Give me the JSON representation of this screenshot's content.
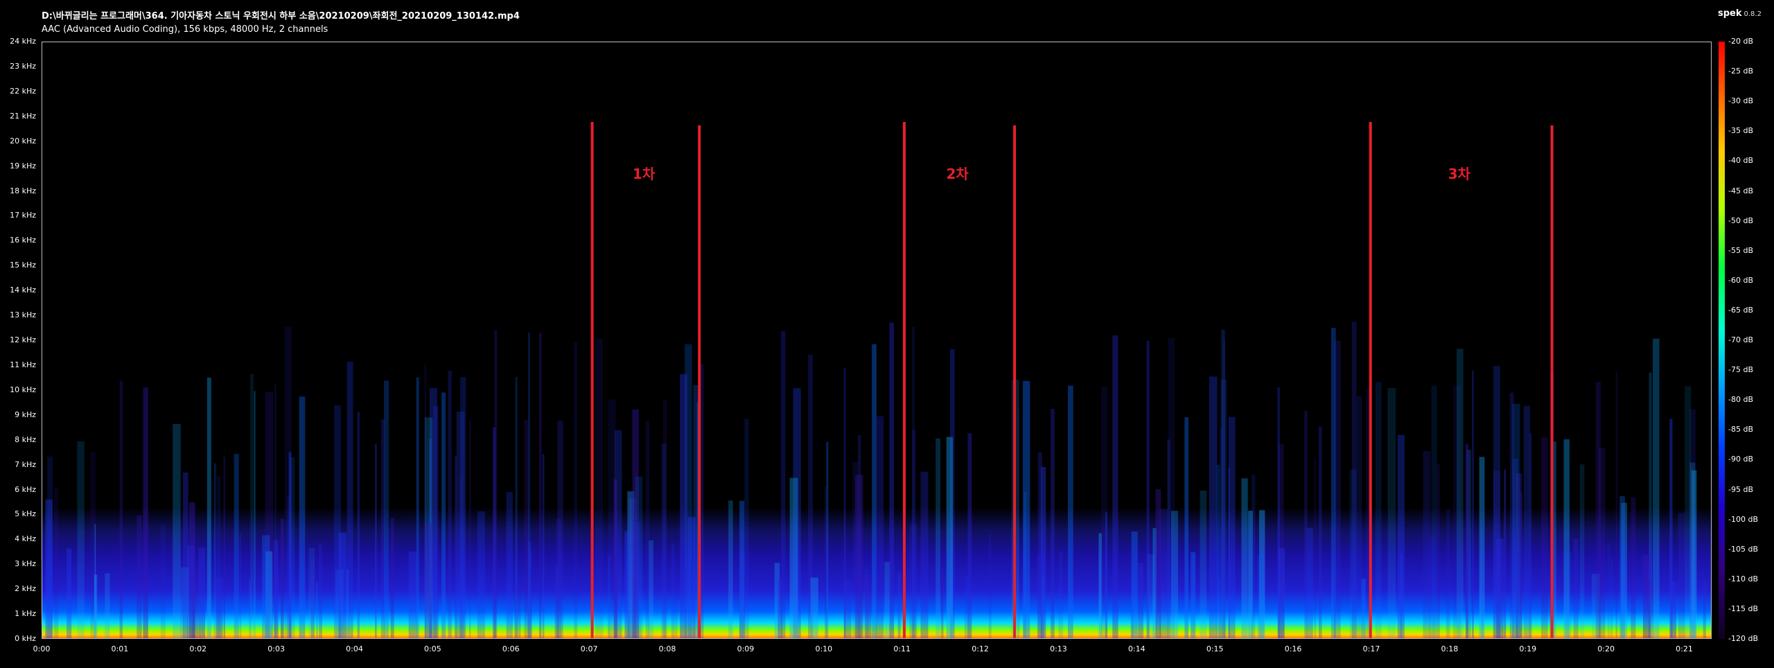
{
  "window": {
    "file_path": "D:\\바뀌글리는 프로그래머\\364. 기아자동차 스토닉 우회전시 하부 소음\\20210209\\좌회전_20210209_130142.mp4",
    "file_info": "AAC (Advanced Audio Coding), 156 kbps, 48000 Hz, 2 channels",
    "app_name": "spek",
    "app_version": "0.8.2"
  },
  "spectrogram": {
    "frequency_ticks": [
      "24 kHz",
      "23 kHz",
      "22 kHz",
      "21 kHz",
      "20 kHz",
      "19 kHz",
      "18 kHz",
      "17 kHz",
      "16 kHz",
      "15 kHz",
      "14 kHz",
      "13 kHz",
      "12 kHz",
      "11 kHz",
      "10 kHz",
      "9 kHz",
      "8 kHz",
      "7 kHz",
      "6 kHz",
      "5 kHz",
      "4 kHz",
      "3 kHz",
      "2 kHz",
      "1 kHz",
      "0 kHz"
    ],
    "time_ticks": [
      "0:00",
      "0:01",
      "0:02",
      "0:03",
      "0:04",
      "0:05",
      "0:06",
      "0:07",
      "0:08",
      "0:09",
      "0:10",
      "0:11",
      "0:12",
      "0:13",
      "0:14",
      "0:15",
      "0:16",
      "0:17",
      "0:18",
      "0:19",
      "0:20",
      "0:21"
    ],
    "db_ticks": [
      "-20 dB",
      "-25 dB",
      "-30 dB",
      "-35 dB",
      "-40 dB",
      "-45 dB",
      "-50 dB",
      "-55 dB",
      "-60 dB",
      "-65 dB",
      "-70 dB",
      "-75 dB",
      "-80 dB",
      "-85 dB",
      "-90 dB",
      "-95 dB",
      "-100 dB",
      "-105 dB",
      "-110 dB",
      "-115 dB",
      "-120 dB"
    ],
    "time_range_seconds": [
      0,
      21.35
    ],
    "frequency_range_khz": [
      0,
      24
    ],
    "db_range": [
      -20,
      -120
    ],
    "colormap_colors": [
      "#ff0000",
      "#ffc800",
      "#00ff40",
      "#00a0ff",
      "#2000d0",
      "#000000"
    ]
  },
  "annotations": {
    "marker_color": "#e8202a",
    "regions": [
      {
        "label": "1차",
        "start_time": 7.03,
        "end_time": 8.4
      },
      {
        "label": "2차",
        "start_time": 11.02,
        "end_time": 12.43
      },
      {
        "label": "3차",
        "start_time": 16.98,
        "end_time": 19.3
      }
    ]
  }
}
